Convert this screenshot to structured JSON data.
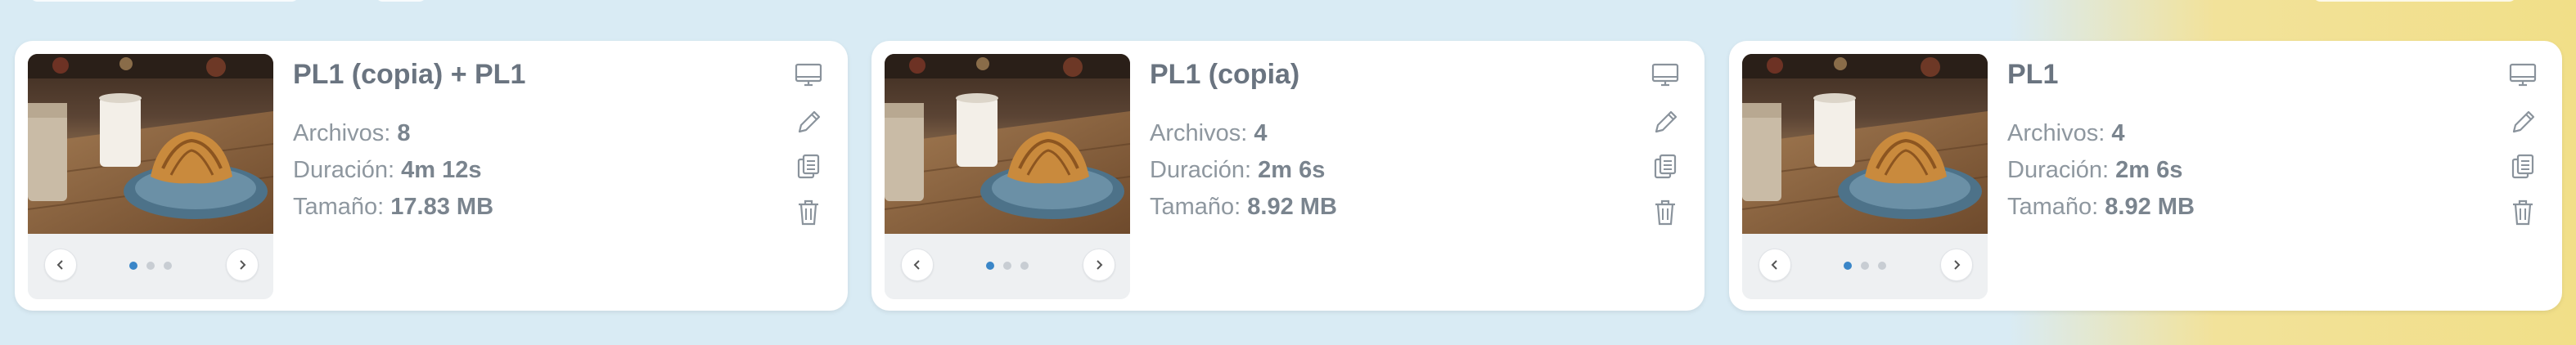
{
  "cards": [
    {
      "title": "PL1 (copia) + PL1",
      "files_label": "Archivos: ",
      "files_value": "8",
      "duration_label": "Duración: ",
      "duration_value": "4m 12s",
      "size_label": "Tamaño: ",
      "size_value": "17.83 MB"
    },
    {
      "title": "PL1 (copia)",
      "files_label": "Archivos: ",
      "files_value": "4",
      "duration_label": "Duración: ",
      "duration_value": "2m 6s",
      "size_label": "Tamaño: ",
      "size_value": "8.92 MB"
    },
    {
      "title": "PL1",
      "files_label": "Archivos: ",
      "files_value": "4",
      "duration_label": "Duración: ",
      "duration_value": "2m 6s",
      "size_label": "Tamaño: ",
      "size_value": "8.92 MB"
    }
  ],
  "icons": {
    "screen": "monitor-icon",
    "edit": "pencil-icon",
    "copy": "clipboard-copy-icon",
    "delete": "trash-icon",
    "prev": "chevron-left-icon",
    "next": "chevron-right-icon"
  },
  "carousel": {
    "slide_count": 3,
    "active_slide": 1
  },
  "colors": {
    "page_background": "#d9ebf4",
    "page_background_accent": "#f1df88",
    "card_background": "#ffffff",
    "title_text": "#6a7480",
    "meta_text": "#8e979f",
    "icon_stroke": "#8a939c",
    "active_dot": "#3a86c8",
    "inactive_dot": "#c8cdd3"
  }
}
